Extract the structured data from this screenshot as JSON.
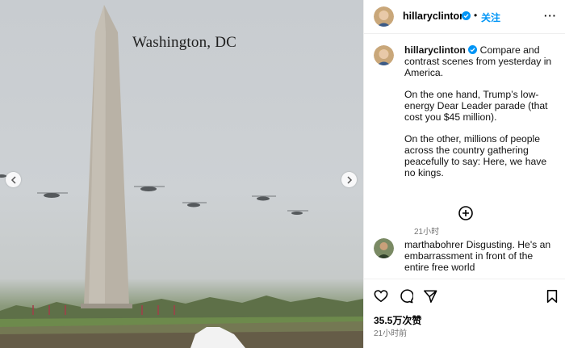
{
  "photo": {
    "caption": "Washington, DC"
  },
  "post": {
    "username": "hillaryclinton",
    "follow_label": "关注",
    "separator": "•",
    "more_label": "···",
    "caption_paragraphs": [
      "Compare and contrast scenes from yesterday in America.",
      "On the one hand, Trump’s low-energy Dear Leader parade (that cost you $45 million).",
      "On the other, millions of people across the country gathering peacefully to say: Here, we have no kings."
    ],
    "caption_time": "21小时",
    "comment": {
      "username": "marthabohrer",
      "text": "Disgusting. He's an embarrassment in front of the entire free world"
    },
    "likes": "35.5万次赞",
    "post_time": "21小时前"
  },
  "icons": {
    "like": "heart-icon",
    "comment": "comment-icon",
    "share": "send-icon",
    "save": "bookmark-icon",
    "add": "add-circle-icon",
    "verified": "verified-badge-icon"
  },
  "colors": {
    "accent": "#0095f6",
    "muted": "#737373"
  }
}
